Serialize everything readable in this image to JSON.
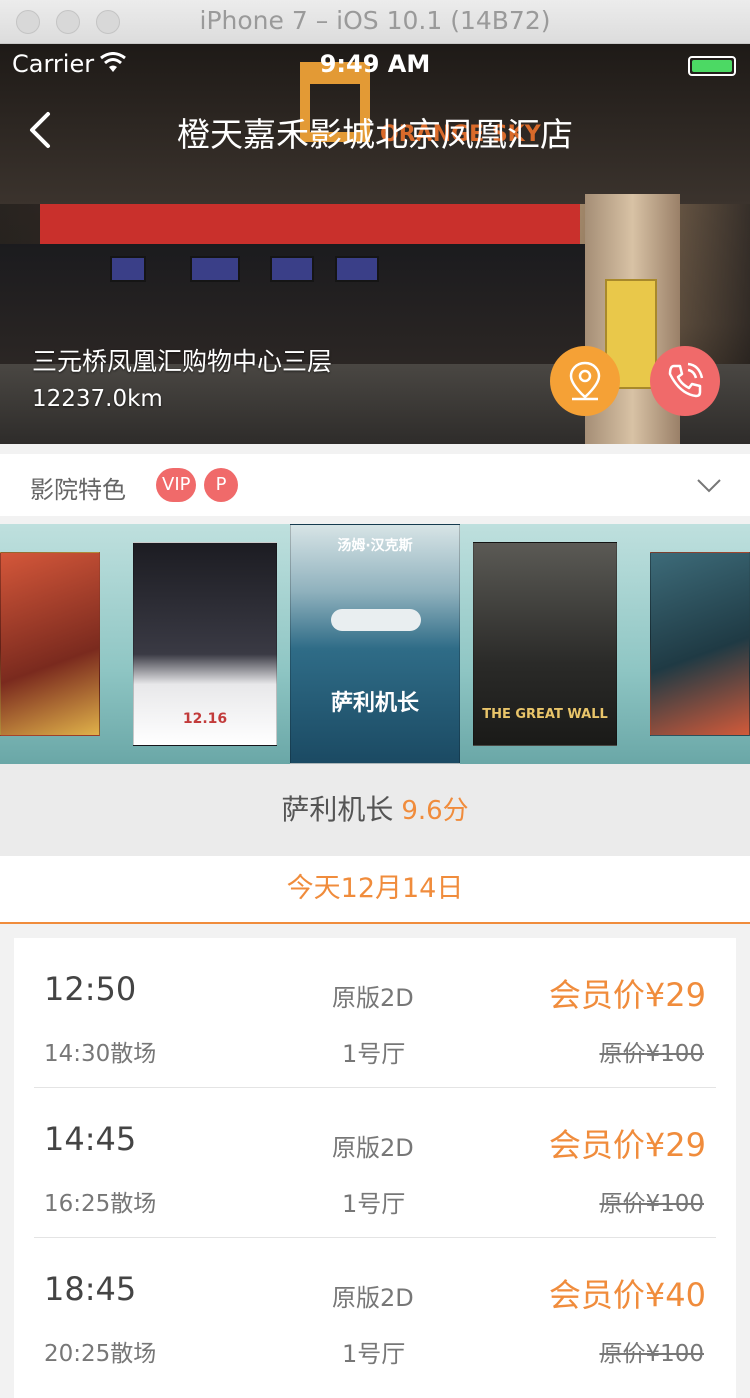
{
  "window": {
    "title": "iPhone 7 – iOS 10.1 (14B72)"
  },
  "status_bar": {
    "carrier": "Carrier",
    "time": "9:49 AM",
    "battery_color": "#4cd964"
  },
  "nav": {
    "title": "橙天嘉禾影城北京凤凰汇店",
    "back_icon": "chevron-left-icon"
  },
  "cinema": {
    "address": "三元桥凤凰汇购物中心三层",
    "distance": "12237.0km",
    "location_icon": "map-pin-icon",
    "phone_icon": "phone-icon"
  },
  "features": {
    "label": "影院特色",
    "badges": [
      "VIP",
      "P"
    ],
    "badge_color": "#f06a6a",
    "expand_icon": "chevron-down-icon"
  },
  "posters": [
    {
      "text": "",
      "color": "#b8462e"
    },
    {
      "text": "12.16",
      "color": "#2a2a33"
    },
    {
      "text": "萨利机长",
      "color": "#2c6f8c",
      "subtitle": "汤姆·汉克斯"
    },
    {
      "text": "THE GREAT WALL",
      "color": "#3a3936"
    },
    {
      "text": "",
      "color": "#2b4f5e"
    }
  ],
  "movie": {
    "title": "萨利机长",
    "score": "9.6分",
    "accent": "#f08c3c"
  },
  "date_tab": {
    "label": "今天12月14日"
  },
  "showtimes": [
    {
      "start": "12:50",
      "end": "14:30散场",
      "version": "原版2D",
      "hall": "1号厅",
      "member_price": "会员价¥29",
      "original_price": "原价¥100"
    },
    {
      "start": "14:45",
      "end": "16:25散场",
      "version": "原版2D",
      "hall": "1号厅",
      "member_price": "会员价¥29",
      "original_price": "原价¥100"
    },
    {
      "start": "18:45",
      "end": "20:25散场",
      "version": "原版2D",
      "hall": "1号厅",
      "member_price": "会员价¥40",
      "original_price": "原价¥100"
    }
  ]
}
